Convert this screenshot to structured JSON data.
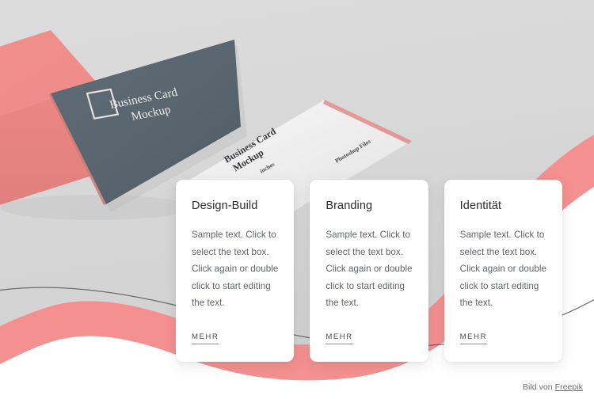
{
  "page": {
    "background_color": "#ffffff",
    "hero_background_color": "#d8d8d8",
    "accent_color": "#f4908f",
    "card_dark_color": "#5a6670",
    "card_light_color": "#efefef",
    "line_color": "#5a5a5a"
  },
  "mockup": {
    "dark_card": {
      "logo_icon": "square-outline-icon",
      "line1": "Business Card",
      "line2": "Mockup"
    },
    "light_card": {
      "line1": "Business Card",
      "line2": "Mockup",
      "unit_label": "inches",
      "format_label": "Photoshop Files"
    }
  },
  "cards": [
    {
      "title": "Design-Build",
      "body": "Sample text. Click to select the text box. Click again or double click to start editing the text.",
      "link": "MEHR"
    },
    {
      "title": "Branding",
      "body": "Sample text. Click to select the text box. Click again or double click to start editing the text.",
      "link": "MEHR"
    },
    {
      "title": "Identität",
      "body": "Sample text. Click to select the text box. Click again or double click to start editing the text.",
      "link": "MEHR"
    }
  ],
  "attribution": {
    "prefix": "Bild von ",
    "link_label": "Freepik"
  }
}
